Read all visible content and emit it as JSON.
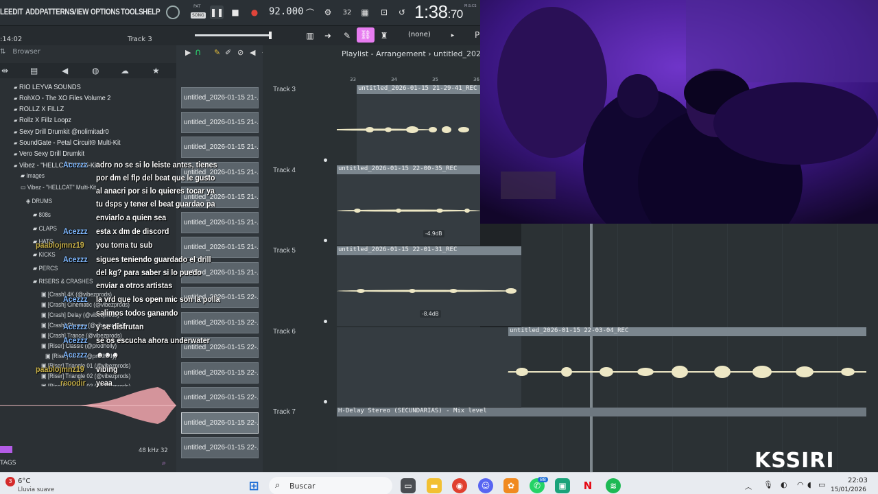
{
  "menu": [
    "LE",
    "EDIT",
    "ADD",
    "PATTERNS",
    "VIEW",
    "OPTIONS",
    "TOOLS",
    "HELP"
  ],
  "transport": {
    "pat_label": "PAT",
    "song_label": "SONG",
    "tempo": "92.000",
    "time_big": "1:38",
    "time_small": ":70",
    "time_unit": "M:S:CS"
  },
  "toolbar2": {
    "hint_left": ":14:02",
    "hint_track": "Track 3",
    "pattern_name": "(none)",
    "pattern_extra": "P"
  },
  "browser": {
    "title": "Browser",
    "items": [
      {
        "label": "RIO LEYVA SOUNDS",
        "icon": "folder-icon"
      },
      {
        "label": "RohXO - The XO Files Volume 2",
        "icon": "folder-icon"
      },
      {
        "label": "ROLLZ X FILLZ",
        "icon": "folder-icon"
      },
      {
        "label": "Rollz X Fillz Loopz",
        "icon": "folder-icon"
      },
      {
        "label": "Sexy Drill Drumkit @nolimitadr0",
        "icon": "folder-icon"
      },
      {
        "label": "SoundGate - Petal Circuit® Multi-Kit",
        "icon": "folder-icon"
      },
      {
        "label": "Vero Sexy Drill Drumkit",
        "icon": "folder-icon"
      },
      {
        "label": "Vibez - \"HELLCAT\" Multi-Kit",
        "icon": "folder-icon"
      }
    ],
    "subitems": [
      {
        "label": "Images"
      },
      {
        "label": "Vibez - \"HELLCAT\" Multi-Kit"
      },
      {
        "label": "DRUMS"
      },
      {
        "label": "808s"
      },
      {
        "label": "CLAPS"
      },
      {
        "label": "HATS"
      },
      {
        "label": "KICKS"
      },
      {
        "label": "PERCS"
      },
      {
        "label": "RISERS & CRASHES"
      }
    ],
    "files": [
      "[Crash] 4K (@vibezprods)",
      "[Crash] Cinematic (@vibezprods)",
      "[Crash] Delay (@vibezprods)",
      "[Crash] Ohnocy (@vibezprods)",
      "[Crash] Trance (@vibezprods)",
      "[Riser] Classic (@prodholly)",
      "[Riser] Noxic (@prodholly)",
      "[Riser] Triangle 01 (@vibezprods)",
      "[Riser] Triangle 02 (@vibezprods)",
      "[Riser] Triangle 03 (@vibezprods)"
    ],
    "sample_rate": "48 kHz 32",
    "tags": "TAGS"
  },
  "picker": [
    "untitled_2026-01-15 21-...",
    "untitled_2026-01-15 21-...",
    "untitled_2026-01-15 21-...",
    "untitled_2026-01-15 21-...",
    "untitled_2026-01-15 21-...",
    "untitled_2026-01-15 21-...",
    "untitled_2026-01-15 21-...",
    "untitled_2026-01-15 21-...",
    "untitled_2026-01-15 22-...",
    "untitled_2026-01-15 22-...",
    "untitled_2026-01-15 22-...",
    "untitled_2026-01-15 22-...",
    "untitled_2026-01-15 22-...",
    "untitled_2026-01-15 22-...",
    "untitled_2026-01-15 22-..."
  ],
  "playlist": {
    "title": "Playlist - Arrangement",
    "pattern": "untitled_2026-",
    "ruler": [
      "33",
      "34",
      "35",
      "36"
    ],
    "tracks": [
      {
        "label": "Track 3",
        "clip": "untitled_2026-01-15 21-29-41_REC"
      },
      {
        "label": "Track 4",
        "clip": "untitled_2026-01-15 22-00-35_REC",
        "db": "-4.9dB"
      },
      {
        "label": "Track 5",
        "clip": "untitled_2026-01-15 22-01-31_REC",
        "db": "-8.4dB"
      },
      {
        "label": "Track 6",
        "clip": "untitled_2026-01-15 22-03-04_REC"
      },
      {
        "label": "Track 7",
        "clip": "H-Delay Stereo (SECUNDARIAS) - Mix level"
      }
    ]
  },
  "chat": [
    {
      "user": "Acezzz",
      "color": "#7fb8ff",
      "text": "adro no se si lo leiste antes, tienes"
    },
    {
      "user": "",
      "color": "",
      "text": "por dm el flp del beat que le gusto"
    },
    {
      "user": "",
      "color": "",
      "text": "al anacri por si lo quieres tocar ya"
    },
    {
      "user": "",
      "color": "",
      "text": "tu dsps y tener el beat guardao pa"
    },
    {
      "user": "",
      "color": "",
      "text": "enviarlo a quien sea"
    },
    {
      "user": "Acezzz",
      "color": "#7fb8ff",
      "text": "esta x dm de discord"
    },
    {
      "user": "paablojmnz19",
      "color": "#c8b14a",
      "text": "you toma tu sub"
    },
    {
      "user": "Acezzz",
      "color": "#7fb8ff",
      "text": "sigues teniendo guardado el drill"
    },
    {
      "user": "",
      "color": "",
      "text": "del kg? para saber si lo puedo"
    },
    {
      "user": "",
      "color": "",
      "text": "enviar a otros artistas"
    },
    {
      "user": "Acezzz",
      "color": "#7fb8ff",
      "text": "la vrd que los open mic son la polla"
    },
    {
      "user": "",
      "color": "",
      "text": "salimos todos ganando"
    },
    {
      "user": "Acezzz",
      "color": "#7fb8ff",
      "text": "y se disfrutan"
    },
    {
      "user": "Acezzz",
      "color": "#7fb8ff",
      "text": "se os escucha ahora underwater"
    },
    {
      "user": "Acezzz",
      "color": "#7fb8ff",
      "text": ""
    },
    {
      "user": "paablojmnz19",
      "color": "#c8b14a",
      "text": "vibing"
    },
    {
      "user": "reoodir",
      "color": "#c8b14a",
      "text": "yeaa"
    }
  ],
  "taskbar": {
    "badge": "3",
    "temp": "6°C",
    "weather": "Lluvia suave",
    "search": "Buscar",
    "time": "22:03",
    "date": "15/01/2026",
    "apps": [
      {
        "icon": "windows-start-icon",
        "color": "#1f6fd6",
        "glyph": "⊞"
      },
      {
        "icon": "file-explorer-icon",
        "color": "#f2c032",
        "glyph": "▬"
      },
      {
        "icon": "chrome-icon",
        "color": "#e0402f",
        "glyph": "◉"
      },
      {
        "icon": "discord-icon",
        "color": "#5865f2",
        "glyph": "☺"
      },
      {
        "icon": "fl-studio-icon",
        "color": "#f08a20",
        "glyph": "✿"
      },
      {
        "icon": "whatsapp-icon",
        "color": "#25d366",
        "glyph": "✆"
      },
      {
        "icon": "app-icon",
        "color": "#1aa37a",
        "glyph": "▣"
      },
      {
        "icon": "netflix-icon",
        "color": "#e50914",
        "glyph": "N"
      },
      {
        "icon": "spotify-icon",
        "color": "#1db954",
        "glyph": "≋"
      }
    ],
    "notification_count": "88"
  },
  "watermark": "KSSIRI"
}
